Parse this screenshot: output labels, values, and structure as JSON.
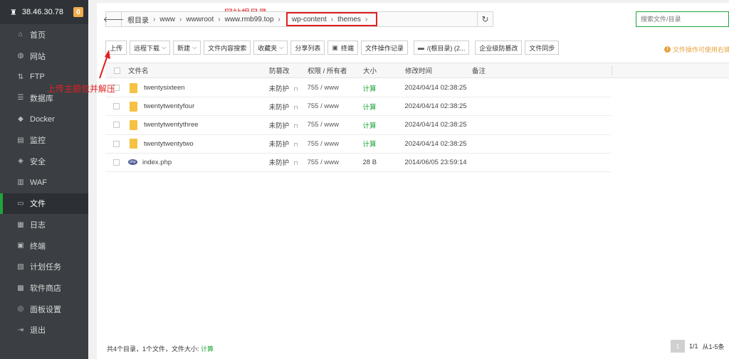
{
  "server": {
    "ip": "38.46.30.78",
    "badge": "0"
  },
  "sidebar": {
    "items": [
      {
        "label": "首页",
        "icon": "home-icon",
        "glyph": "⌂"
      },
      {
        "label": "网站",
        "icon": "globe-icon",
        "glyph": "◍"
      },
      {
        "label": "FTP",
        "icon": "ftp-icon",
        "glyph": "⇅"
      },
      {
        "label": "数据库",
        "icon": "database-icon",
        "glyph": "☰"
      },
      {
        "label": "Docker",
        "icon": "docker-icon",
        "glyph": "◆"
      },
      {
        "label": "监控",
        "icon": "monitor-icon",
        "glyph": "▤"
      },
      {
        "label": "安全",
        "icon": "shield-icon",
        "glyph": "◈"
      },
      {
        "label": "WAF",
        "icon": "waf-icon",
        "glyph": "▥"
      },
      {
        "label": "文件",
        "icon": "folder-icon",
        "glyph": "▭"
      },
      {
        "label": "日志",
        "icon": "log-icon",
        "glyph": "▦"
      },
      {
        "label": "终端",
        "icon": "terminal-icon",
        "glyph": "▣"
      },
      {
        "label": "计划任务",
        "icon": "cron-icon",
        "glyph": "▧"
      },
      {
        "label": "软件商店",
        "icon": "store-icon",
        "glyph": "▩"
      },
      {
        "label": "面板设置",
        "icon": "settings-icon",
        "glyph": "◎"
      },
      {
        "label": "退出",
        "icon": "logout-icon",
        "glyph": "⇥"
      }
    ],
    "active_index": 8
  },
  "path": {
    "crumbs": [
      "根目录",
      "www",
      "wwwroot",
      "www.rmb99.top"
    ],
    "highlighted": [
      "wp-content",
      "themes"
    ]
  },
  "search": {
    "placeholder": "搜索文件/目录"
  },
  "annotations": {
    "top": "网站根目录",
    "left": "上传主题包并解压"
  },
  "toolbar": {
    "upload": "上传",
    "remote_download": "远程下载",
    "new": "新建",
    "content_search": "文件内容搜索",
    "favorites": "收藏夹",
    "share_list": "分享列表",
    "terminal": "终端",
    "op_log": "文件操作记录",
    "disk": "/(根目录) (2...",
    "tamper": "企业级防篡改",
    "sync": "文件同步",
    "tip": "文件操作可使用右键"
  },
  "table": {
    "headers": {
      "name": "文件名",
      "guard": "防篡改",
      "perm": "权限 / 所有者",
      "size": "大小",
      "mtime": "修改时间",
      "note": "备注"
    },
    "rows": [
      {
        "type": "folder",
        "name": "twentysixteen",
        "guard": "未防护",
        "perm": "755 / www",
        "size": "计算",
        "mtime": "2024/04/14 02:38:25"
      },
      {
        "type": "folder",
        "name": "twentytwentyfour",
        "guard": "未防护",
        "perm": "755 / www",
        "size": "计算",
        "mtime": "2024/04/14 02:38:25"
      },
      {
        "type": "folder",
        "name": "twentytwentythree",
        "guard": "未防护",
        "perm": "755 / www",
        "size": "计算",
        "mtime": "2024/04/14 02:38:25"
      },
      {
        "type": "folder",
        "name": "twentytwentytwo",
        "guard": "未防护",
        "perm": "755 / www",
        "size": "计算",
        "mtime": "2024/04/14 02:38:25"
      },
      {
        "type": "php",
        "name": "index.php",
        "guard": "未防护",
        "perm": "755 / www",
        "size": "28 B",
        "mtime": "2014/06/05 23:59:14"
      }
    ]
  },
  "footer": {
    "summary": "共4个目录，1个文件，文件大小:",
    "calc": "计算"
  },
  "pager": {
    "current": "1",
    "pages": "1/1",
    "range": "从1-5条"
  },
  "colors": {
    "accent": "#20a53a",
    "annotation": "#e02020",
    "sidebar": "#3b3f43"
  }
}
